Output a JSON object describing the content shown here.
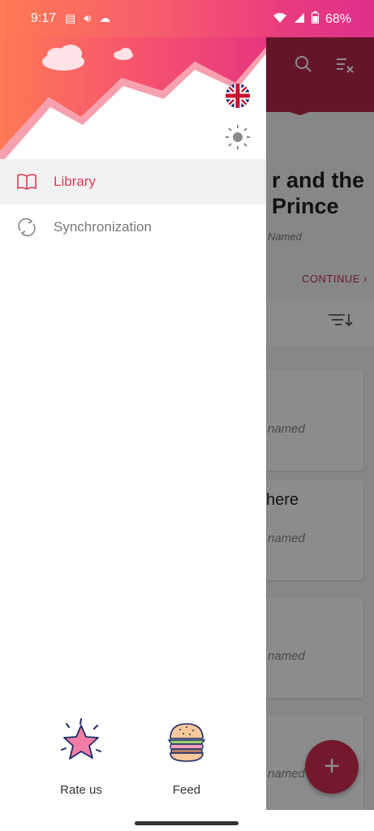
{
  "status": {
    "time": "9:17",
    "battery": "68%"
  },
  "background": {
    "book_title": "r and the Prince",
    "author": "Named",
    "continue_label": "CONTINUE",
    "cards": [
      {
        "title": "",
        "author": "named"
      },
      {
        "title": "here",
        "author": "named"
      },
      {
        "title": "",
        "author": "named"
      },
      {
        "title": "",
        "author": "named"
      }
    ]
  },
  "drawer": {
    "menu": [
      {
        "label": "Library",
        "icon": "book-icon",
        "active": true
      },
      {
        "label": "Synchronization",
        "icon": "sync-icon",
        "active": false
      }
    ],
    "actions": {
      "rate": "Rate us",
      "feed": "Feed"
    }
  },
  "colors": {
    "accent": "#d63d5b",
    "gradient_start": "#ff7a55",
    "gradient_end": "#df2f8a"
  }
}
